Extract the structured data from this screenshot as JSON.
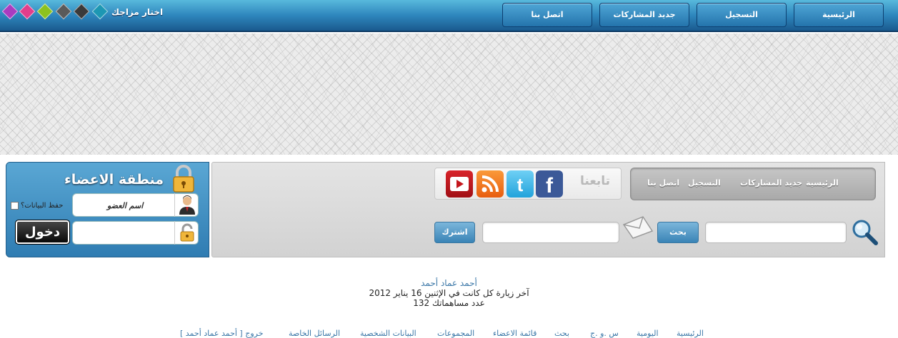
{
  "top_nav": [
    {
      "label": "الرئيسية"
    },
    {
      "label": "التسجيل"
    },
    {
      "label": "جديد المشاركات"
    },
    {
      "label": "اتصل بنا"
    }
  ],
  "theme": {
    "label": "اختار مزاجك",
    "swatches": [
      "#1d97b3",
      "#3a3a3a",
      "#5a5a5a",
      "#8dc21f",
      "#e23e8b",
      "#a93cc0"
    ]
  },
  "quick_nav": [
    "الرئيسية",
    "جديد المشاركات",
    "التسجيل",
    "اتصل بنا"
  ],
  "follow": {
    "label": "تابعنا",
    "icons": [
      "facebook-icon",
      "twitter-icon",
      "rss-icon",
      "youtube-icon"
    ]
  },
  "search": {
    "button": "بحث",
    "subscribe_button": "اشترك"
  },
  "login": {
    "title": "منطقة الاعضاء",
    "username_label": "اسم العضو",
    "login_button": "دخول",
    "remember_label": "حفظ البيانات؟"
  },
  "user": {
    "name": "أحمد عماد أحمد",
    "last_visit": "آخر زيارة كل كانت في الإثنين 16 يناير 2012",
    "post_count": "عدد مساهماتك 132"
  },
  "bottom_nav": [
    "الرئيسية",
    "اليومية",
    "س .و .ج",
    "بحث",
    "قائمة الاعضاء",
    "المجموعات",
    "البيانات الشخصية",
    "الرسائل الخاصة",
    "خروج [ أحمد عماد أحمد ]"
  ]
}
